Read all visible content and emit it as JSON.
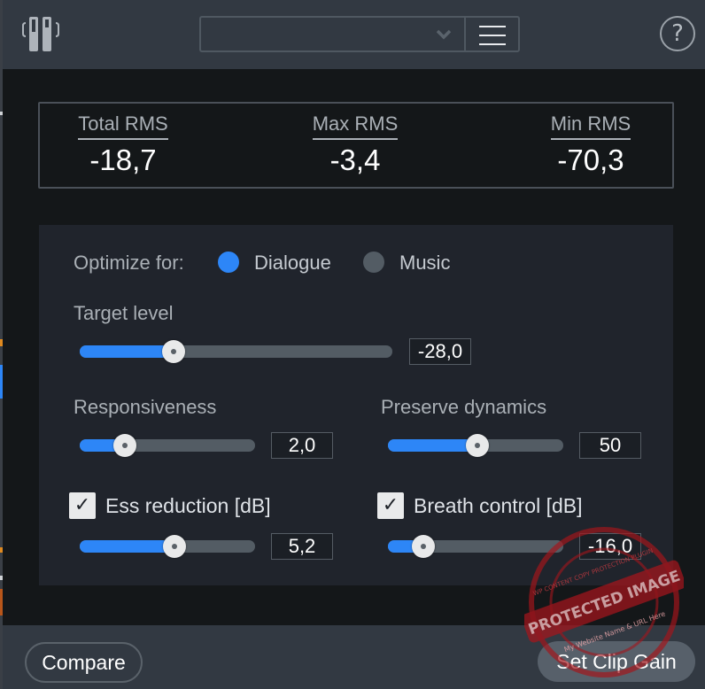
{
  "header": {
    "preset_value": "",
    "help_label": "?"
  },
  "rms": [
    {
      "label": "Total RMS",
      "value": "-18,7"
    },
    {
      "label": "Max RMS",
      "value": "-3,4"
    },
    {
      "label": "Min RMS",
      "value": "-70,3"
    }
  ],
  "optimize": {
    "label": "Optimize for:",
    "options": [
      {
        "label": "Dialogue",
        "selected": true
      },
      {
        "label": "Music",
        "selected": false
      }
    ]
  },
  "target_level": {
    "label": "Target level",
    "value": "-28,0",
    "fraction": 0.3
  },
  "responsiveness": {
    "label": "Responsiveness",
    "value": "2,0",
    "fraction": 0.26
  },
  "preserve_dynamics": {
    "label": "Preserve dynamics",
    "value": "50",
    "fraction": 0.51
  },
  "ess_reduction": {
    "label": "Ess reduction [dB]",
    "checked": true,
    "check_glyph": "✓",
    "value": "5,2",
    "fraction": 0.54
  },
  "breath_control": {
    "label": "Breath control [dB]",
    "checked": true,
    "check_glyph": "✓",
    "value": "-16,0",
    "fraction": 0.2
  },
  "footer": {
    "compare_label": "Compare",
    "set_clip_gain_label": "Set Clip Gain"
  },
  "watermark": {
    "text": "PROTECTED IMAGE",
    "subtext": "My Website Name & URL Here",
    "ring_text": "WP CONTENT COPY PROTECTION PLUGIN"
  },
  "colors": {
    "accent": "#2d86f7",
    "header_bg": "#323942",
    "panel_bg": "#20242c",
    "main_bg": "#141719",
    "radio_off": "#535c64",
    "watermark": "#a4151c"
  }
}
